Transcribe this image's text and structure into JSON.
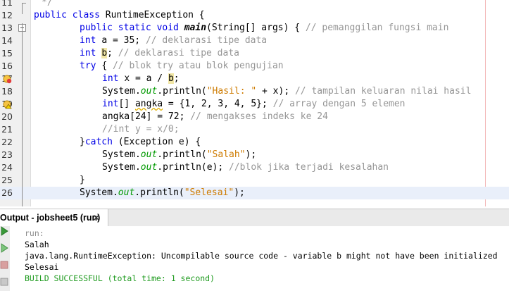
{
  "editor": {
    "lines": [
      {
        "n": "11",
        "segs": [
          {
            "t": "*/",
            "c": "cm"
          }
        ],
        "indent": 59
      },
      {
        "n": "12",
        "segs": [
          {
            "t": "public class ",
            "c": "kw"
          },
          {
            "t": "RuntimeException {",
            "c": ""
          }
        ],
        "indent": 48
      },
      {
        "n": "13",
        "segs": [
          {
            "t": "public static void ",
            "c": "kw"
          },
          {
            "t": "main",
            "c": "bm"
          },
          {
            "t": "(String[] args) { ",
            "c": ""
          },
          {
            "t": "// pemanggilan fungsi main",
            "c": "cm"
          }
        ],
        "indent": 113
      },
      {
        "n": "14",
        "segs": [
          {
            "t": "int ",
            "c": "kw"
          },
          {
            "t": "a = 35; ",
            "c": ""
          },
          {
            "t": "// deklarasi tipe data",
            "c": "cm"
          }
        ],
        "indent": 113
      },
      {
        "n": "15",
        "segs": [
          {
            "t": "int ",
            "c": "kw"
          },
          {
            "t": "b",
            "c": "hl"
          },
          {
            "t": "; ",
            "c": ""
          },
          {
            "t": "// deklarasi tipe data",
            "c": "cm"
          }
        ],
        "indent": 113
      },
      {
        "n": "16",
        "segs": [
          {
            "t": "try ",
            "c": "kw"
          },
          {
            "t": "{ ",
            "c": ""
          },
          {
            "t": "// blok try atau blok pengujian",
            "c": "cm"
          }
        ],
        "indent": 113
      },
      {
        "n": "17",
        "segs": [
          {
            "t": "int ",
            "c": "kw"
          },
          {
            "t": "x = a / ",
            "c": ""
          },
          {
            "t": "b",
            "c": "hl"
          },
          {
            "t": ";",
            "c": ""
          }
        ],
        "indent": 145
      },
      {
        "n": "18",
        "segs": [
          {
            "t": "System.",
            "c": ""
          },
          {
            "t": "out",
            "c": "it"
          },
          {
            "t": ".println(",
            "c": ""
          },
          {
            "t": "\"Hasil: \"",
            "c": "str"
          },
          {
            "t": " + x); ",
            "c": ""
          },
          {
            "t": "// tampilan keluaran nilai hasil",
            "c": "cm"
          }
        ],
        "indent": 145
      },
      {
        "n": "19",
        "segs": [
          {
            "t": "int",
            "c": "kw"
          },
          {
            "t": "[] ",
            "c": ""
          },
          {
            "t": "angka",
            "c": "wu"
          },
          {
            "t": " = {1, 2, 3, 4, 5}; ",
            "c": ""
          },
          {
            "t": "// array dengan 5 elemen",
            "c": "cm"
          }
        ],
        "indent": 145
      },
      {
        "n": "20",
        "segs": [
          {
            "t": "angka[24] = 72; ",
            "c": ""
          },
          {
            "t": "// mengakses indeks ke 24",
            "c": "cm"
          }
        ],
        "indent": 145
      },
      {
        "n": "21",
        "segs": [
          {
            "t": "//int y = x/0;",
            "c": "cm"
          }
        ],
        "indent": 145
      },
      {
        "n": "22",
        "segs": [
          {
            "t": "}",
            "c": ""
          },
          {
            "t": "catch ",
            "c": "kw"
          },
          {
            "t": "(Exception e) {",
            "c": ""
          }
        ],
        "indent": 113
      },
      {
        "n": "23",
        "segs": [
          {
            "t": "System.",
            "c": ""
          },
          {
            "t": "out",
            "c": "it"
          },
          {
            "t": ".println(",
            "c": ""
          },
          {
            "t": "\"Salah\"",
            "c": "str"
          },
          {
            "t": ");",
            "c": ""
          }
        ],
        "indent": 145
      },
      {
        "n": "24",
        "segs": [
          {
            "t": "System.",
            "c": ""
          },
          {
            "t": "out",
            "c": "it"
          },
          {
            "t": ".println(e); ",
            "c": ""
          },
          {
            "t": "//blok jika terjadi kesalahan",
            "c": "cm"
          }
        ],
        "indent": 145
      },
      {
        "n": "25",
        "segs": [
          {
            "t": "}",
            "c": ""
          }
        ],
        "indent": 113
      },
      {
        "n": "26",
        "segs": [
          {
            "t": "System.",
            "c": ""
          },
          {
            "t": "out",
            "c": "it"
          },
          {
            "t": ".println(",
            "c": ""
          },
          {
            "t": "\"Selesai\"",
            "c": "str"
          },
          {
            "t": ");",
            "c": ""
          }
        ],
        "indent": 113
      }
    ]
  },
  "output_panel": {
    "tab_label": "Output - jobsheet5 (run)",
    "close_glyph": "✕",
    "lines": [
      {
        "t": "run:",
        "c": "out-gray"
      },
      {
        "t": "Salah",
        "c": ""
      },
      {
        "t": "java.lang.RuntimeException: Uncompilable source code - variable b might not have been initialized",
        "c": ""
      },
      {
        "t": "Selesai",
        "c": ""
      },
      {
        "t": "BUILD SUCCESSFUL (total time: 1 second)",
        "c": "out-green"
      }
    ]
  },
  "colors": {
    "keyword": "#0000e6",
    "comment": "#969696",
    "string": "#ce7b00",
    "field": "#009900",
    "success": "#1f9b1f"
  }
}
